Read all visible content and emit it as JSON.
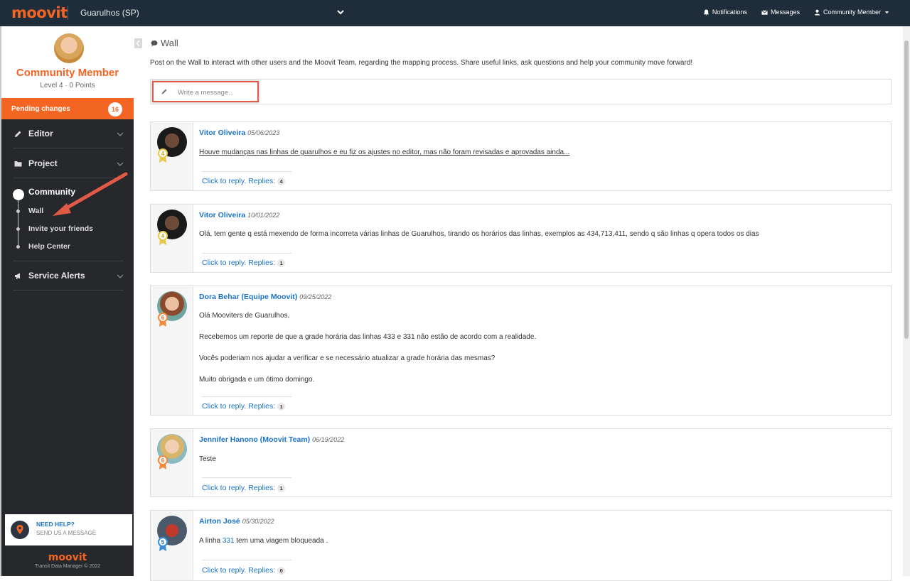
{
  "topbar": {
    "logo": "moovit",
    "city": "Guarulhos (SP)",
    "notifications": "Notifications",
    "messages": "Messages",
    "user_menu": "Community Member"
  },
  "profile": {
    "name": "Community Member",
    "level": "Level 4 · 0 Points"
  },
  "pending": {
    "label": "Pending changes",
    "count": "16"
  },
  "nav": {
    "editor": "Editor",
    "project": "Project",
    "community": "Community",
    "community_items": [
      "Wall",
      "Invite your friends",
      "Help Center"
    ],
    "service_alerts": "Service Alerts"
  },
  "help": {
    "title": "NEED HELP?",
    "subtitle": "SEND US A MESSAGE"
  },
  "footer": {
    "logo": "moovit",
    "copyright": "Transit Data Manager © 2022"
  },
  "main": {
    "title": "Wall",
    "intro": "Post on the Wall to interact with other users and the Moovit Team, regarding the mapping process. Share useful links, ask questions and help your community move forward!",
    "composer_placeholder": "Write a message..."
  },
  "posts": [
    {
      "author": "Vitor Oliveira",
      "date": "05/06/2023",
      "badge": "4",
      "lines": [
        "Houve mudanças nas linhas de guarulhos e eu fiz os ajustes no editor, mas não foram revisadas e aprovadas ainda..."
      ],
      "reply_label": "Click to reply.",
      "replies_label": "Replies:",
      "replies": "4"
    },
    {
      "author": "Vitor Oliveira",
      "date": "10/01/2022",
      "badge": "4",
      "lines": [
        "Olá, tem gente q está mexendo de forma incorreta várias linhas de Guarulhos, tirando os horários das linhas, exemplos as 434,713,411, sendo q são linhas q opera todos os dias"
      ],
      "reply_label": "Click to reply.",
      "replies_label": "Replies:",
      "replies": "1"
    },
    {
      "author": "Dora Behar (Equipe Moovit)",
      "date": "09/25/2022",
      "badge": "6",
      "lines": [
        "Olá Mooviters de Guarulhos,",
        "Recebemos um reporte de que a grade horária das linhas 433 e 331 não estão de acordo com a realidade.",
        "Vocês poderiam nos ajudar a verificar e se necessário atualizar a grade horária das mesmas?",
        "Muito obrigada e um ótimo domingo."
      ],
      "reply_label": "Click to reply.",
      "replies_label": "Replies:",
      "replies": "1"
    },
    {
      "author": "Jennifer Hanono (Moovit Team)",
      "date": "06/19/2022",
      "badge": "6",
      "lines": [
        "Teste"
      ],
      "reply_label": "Click to reply.",
      "replies_label": "Replies:",
      "replies": "1"
    },
    {
      "author": "Airton José",
      "date": "05/30/2022",
      "badge": "5",
      "line_prefix": "A linha",
      "line_link": "331",
      "line_suffix": "tem uma viagem bloqueada .",
      "reply_label": "Click to reply.",
      "replies_label": "Replies:",
      "replies": "0"
    }
  ],
  "colors": {
    "brand": "#f26522",
    "topbar": "#1f2d3a",
    "sidebar": "#26282c",
    "link": "#1a73c8",
    "highlight": "#e05a47"
  }
}
